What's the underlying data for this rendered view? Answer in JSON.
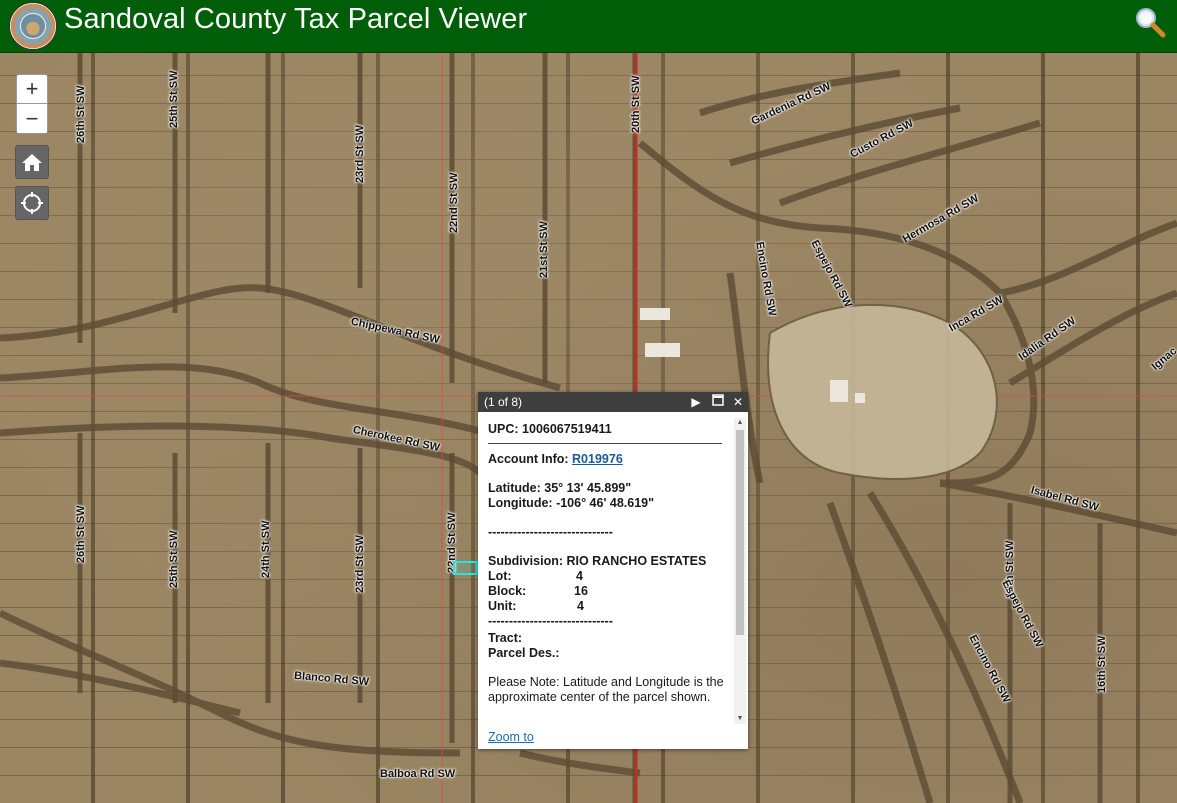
{
  "header": {
    "title": "Sandoval County Tax Parcel Viewer",
    "logo_icon": "county-seal-icon",
    "search_icon": "magnifier-icon"
  },
  "controls": {
    "zoom_in": "+",
    "zoom_out": "−",
    "home_icon": "home-icon",
    "locate_icon": "locate-icon"
  },
  "roads": [
    {
      "label": "26th St SW"
    },
    {
      "label": "25th St SW"
    },
    {
      "label": "23rd St SW"
    },
    {
      "label": "22nd St SW"
    },
    {
      "label": "21st St SW"
    },
    {
      "label": "20th St SW"
    },
    {
      "label": "Gardenia Rd SW"
    },
    {
      "label": "Custo Rd SW"
    },
    {
      "label": "Hermosa Rd SW"
    },
    {
      "label": "Espejo Rd SW"
    },
    {
      "label": "Encino Rd SW"
    },
    {
      "label": "Inca Rd SW"
    },
    {
      "label": "Idalia Rd SW"
    },
    {
      "label": "Chippewa Rd SW"
    },
    {
      "label": "Cherokee Rd SW"
    },
    {
      "label": "Isabel Rd SW"
    },
    {
      "label": "24th St SW"
    },
    {
      "label": "18th St SW"
    },
    {
      "label": "16th St SW"
    },
    {
      "label": "Blanco Rd SW"
    },
    {
      "label": "Balboa Rd SW"
    },
    {
      "label": "Ignac"
    }
  ],
  "popup": {
    "counter": "(1 of 8)",
    "upc_label": "UPC:",
    "upc": "1006067519411",
    "account_label": "Account Info:",
    "account": "R019976",
    "lat_label": "Latitude:",
    "lat": "35° 13' 45.899\"",
    "lon_label": "Longitude:",
    "lon": "-106° 46' 48.619\"",
    "dashes": "------------------------------",
    "subdivision_label": "Subdivision:",
    "subdivision": "RIO RANCHO ESTATES",
    "lot_label": "Lot:",
    "lot": "4",
    "block_label": "Block:",
    "block": "16",
    "unit_label": "Unit:",
    "unit": "4",
    "tract_label": "Tract:",
    "parcel_label": "Parcel Des.:",
    "note": "Please Note: Latitude and Longitude is the approximate center of the parcel shown.",
    "zoom_to": "Zoom to"
  }
}
